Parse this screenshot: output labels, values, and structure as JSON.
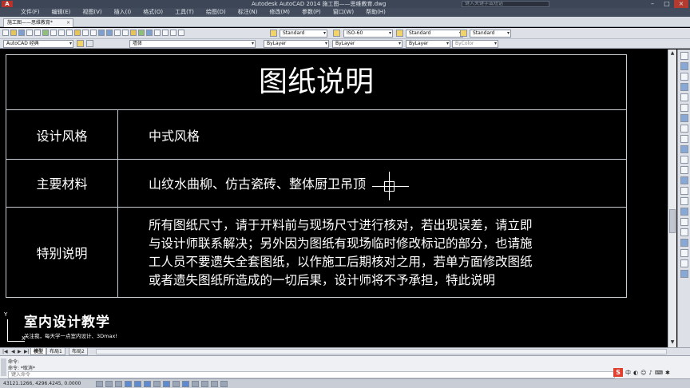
{
  "window": {
    "app_icon": "A",
    "title": "Autodesk AutoCAD 2014   施工图——思维教育.dwg",
    "search_placeholder": "键入关键字或短语",
    "minimize": "–",
    "maximize": "□",
    "close": "×"
  },
  "menu": [
    "文件(F)",
    "编辑(E)",
    "视图(V)",
    "插入(I)",
    "格式(O)",
    "工具(T)",
    "绘图(D)",
    "标注(N)",
    "修改(M)",
    "参数(P)",
    "窗口(W)",
    "帮助(H)"
  ],
  "file_tab": {
    "label": "施工图——思维教育*",
    "close": "×"
  },
  "toolbar1": {
    "workspace": "AutoCAD 经典",
    "text_style": "Standard",
    "dim_style": "ISO-60",
    "table_style": "Standard",
    "multileader_style": "Standard"
  },
  "toolbar2": {
    "workspace": "AutoCAD 经典",
    "layer": "墙体",
    "color": "ByLayer",
    "linetype": "ByLayer",
    "lineweight": "ByLayer",
    "plotstyle": "ByColor"
  },
  "drawing": {
    "title": "图纸说明",
    "rows": [
      {
        "label": "设计风格",
        "value": "中式风格"
      },
      {
        "label": "主要材料",
        "value": "山纹水曲柳、仿古瓷砖、整体厨卫吊顶"
      },
      {
        "label": "特别说明",
        "lines": [
          "所有图纸尺寸，请于开料前与现场尺寸进行核对，若出现误差，请立即",
          "与设计师联系解决；另外因为图纸有现场临时修改标记的部分，也请施",
          "工人员不要遗失全套图纸，以作施工后期核对之用，若单方面修改图纸",
          "或者遗失图纸所造成的一切后果，设计师将不予承担，特此说明"
        ]
      }
    ]
  },
  "watermark": {
    "title": "室内设计教学",
    "subtitle": "关注我，每天学一点室内设计、3Dmax!"
  },
  "ucs": {
    "x": "X",
    "y": "Y"
  },
  "layout_tabs": [
    "模型",
    "布局1",
    "布局2"
  ],
  "command": {
    "history": [
      "命令:",
      "命令: *取消*"
    ],
    "placeholder": "键入命令"
  },
  "ime": {
    "logo": "S",
    "lang": "中"
  },
  "status": {
    "coords": "43121.1266, 4296.4245, 0.0000"
  }
}
